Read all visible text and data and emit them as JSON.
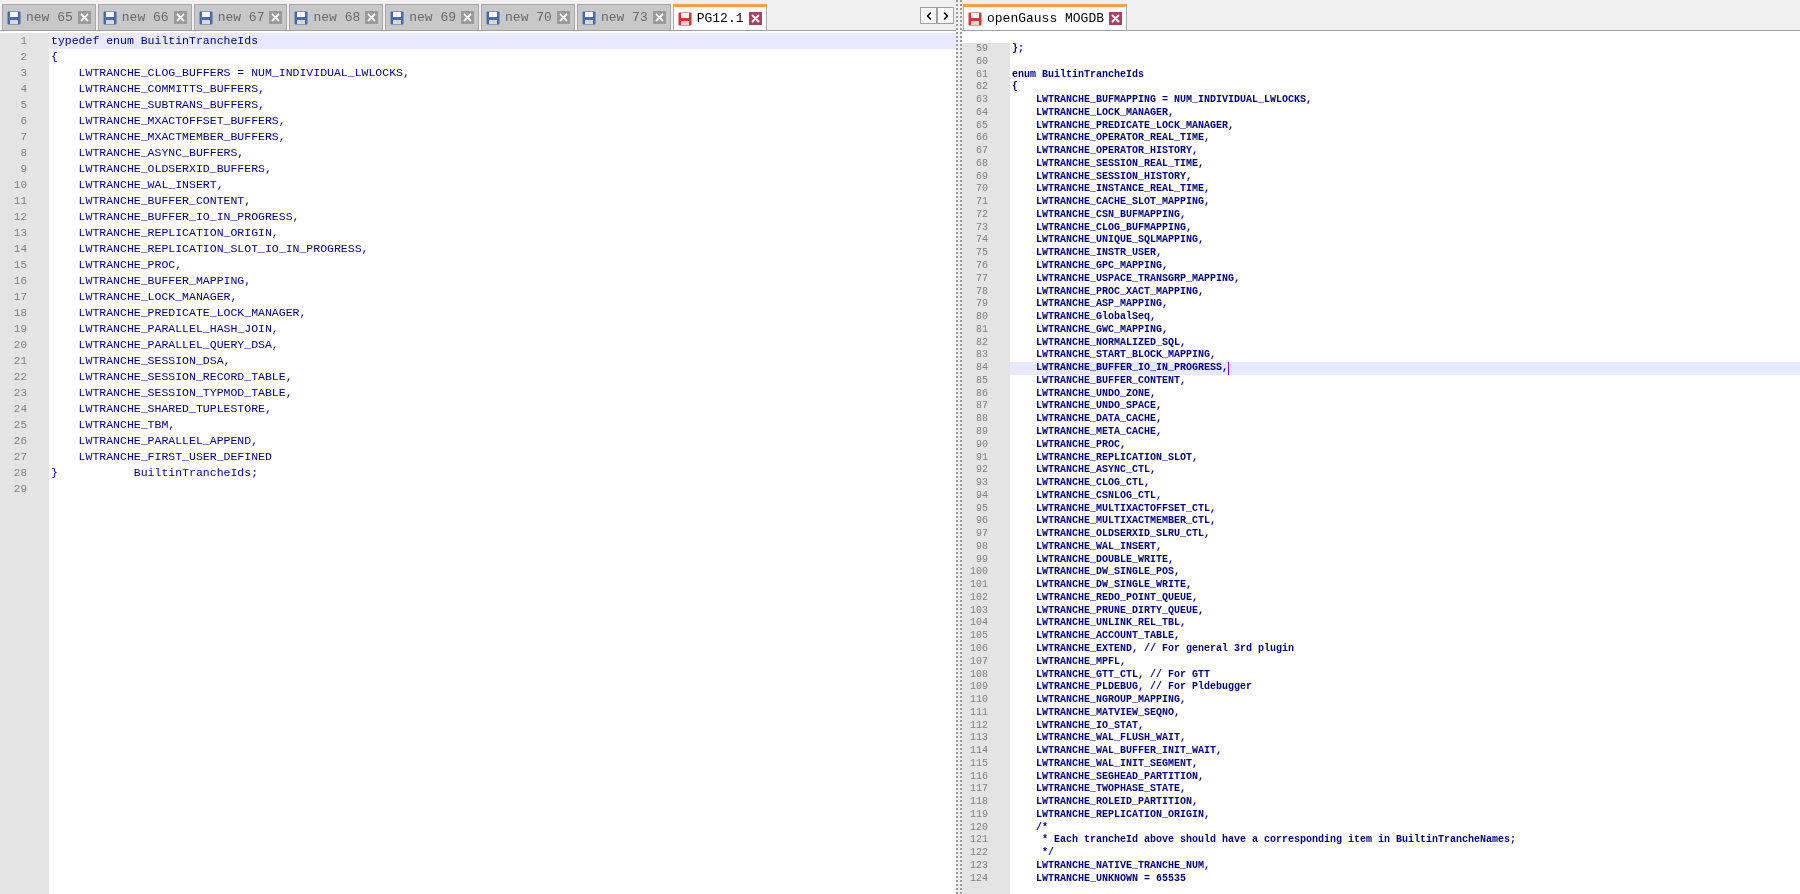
{
  "left_pane": {
    "tabs": [
      {
        "label": "new 65",
        "selected": false,
        "modified": false
      },
      {
        "label": "new 66",
        "selected": false,
        "modified": false
      },
      {
        "label": "new 67",
        "selected": false,
        "modified": false
      },
      {
        "label": "new 68",
        "selected": false,
        "modified": false
      },
      {
        "label": "new 69",
        "selected": false,
        "modified": false
      },
      {
        "label": "new 70",
        "selected": false,
        "modified": false
      },
      {
        "label": "new 73",
        "selected": false,
        "modified": false
      },
      {
        "label": "PG12.1",
        "selected": true,
        "modified": true
      }
    ],
    "lines": [
      {
        "number": "1",
        "text": "typedef enum BuiltinTrancheIds",
        "current": true
      },
      {
        "number": "2",
        "text": "{",
        "current": false
      },
      {
        "number": "3",
        "text": "    LWTRANCHE_CLOG_BUFFERS = NUM_INDIVIDUAL_LWLOCKS,",
        "current": false
      },
      {
        "number": "4",
        "text": "    LWTRANCHE_COMMITTS_BUFFERS,",
        "current": false
      },
      {
        "number": "5",
        "text": "    LWTRANCHE_SUBTRANS_BUFFERS,",
        "current": false
      },
      {
        "number": "6",
        "text": "    LWTRANCHE_MXACTOFFSET_BUFFERS,",
        "current": false
      },
      {
        "number": "7",
        "text": "    LWTRANCHE_MXACTMEMBER_BUFFERS,",
        "current": false
      },
      {
        "number": "8",
        "text": "    LWTRANCHE_ASYNC_BUFFERS,",
        "current": false
      },
      {
        "number": "9",
        "text": "    LWTRANCHE_OLDSERXID_BUFFERS,",
        "current": false
      },
      {
        "number": "10",
        "text": "    LWTRANCHE_WAL_INSERT,",
        "current": false
      },
      {
        "number": "11",
        "text": "    LWTRANCHE_BUFFER_CONTENT,",
        "current": false
      },
      {
        "number": "12",
        "text": "    LWTRANCHE_BUFFER_IO_IN_PROGRESS,",
        "current": false
      },
      {
        "number": "13",
        "text": "    LWTRANCHE_REPLICATION_ORIGIN,",
        "current": false
      },
      {
        "number": "14",
        "text": "    LWTRANCHE_REPLICATION_SLOT_IO_IN_PROGRESS,",
        "current": false
      },
      {
        "number": "15",
        "text": "    LWTRANCHE_PROC,",
        "current": false
      },
      {
        "number": "16",
        "text": "    LWTRANCHE_BUFFER_MAPPING,",
        "current": false
      },
      {
        "number": "17",
        "text": "    LWTRANCHE_LOCK_MANAGER,",
        "current": false
      },
      {
        "number": "18",
        "text": "    LWTRANCHE_PREDICATE_LOCK_MANAGER,",
        "current": false
      },
      {
        "number": "19",
        "text": "    LWTRANCHE_PARALLEL_HASH_JOIN,",
        "current": false
      },
      {
        "number": "20",
        "text": "    LWTRANCHE_PARALLEL_QUERY_DSA,",
        "current": false
      },
      {
        "number": "21",
        "text": "    LWTRANCHE_SESSION_DSA,",
        "current": false
      },
      {
        "number": "22",
        "text": "    LWTRANCHE_SESSION_RECORD_TABLE,",
        "current": false
      },
      {
        "number": "23",
        "text": "    LWTRANCHE_SESSION_TYPMOD_TABLE,",
        "current": false
      },
      {
        "number": "24",
        "text": "    LWTRANCHE_SHARED_TUPLESTORE,",
        "current": false
      },
      {
        "number": "25",
        "text": "    LWTRANCHE_TBM,",
        "current": false
      },
      {
        "number": "26",
        "text": "    LWTRANCHE_PARALLEL_APPEND,",
        "current": false
      },
      {
        "number": "27",
        "text": "    LWTRANCHE_FIRST_USER_DEFINED",
        "current": false
      },
      {
        "number": "28",
        "text": "}           BuiltinTrancheIds;",
        "current": false
      },
      {
        "number": "29",
        "current": false
      }
    ]
  },
  "right_pane": {
    "tabs": [
      {
        "label": "openGauss MOGDB",
        "selected": true,
        "modified": true
      }
    ],
    "caret": true,
    "lines": [
      {
        "number": "59",
        "text": "};",
        "current": false
      },
      {
        "number": "60",
        "current": false
      },
      {
        "number": "61",
        "text": "enum BuiltinTrancheIds",
        "current": false
      },
      {
        "number": "62",
        "text": "{",
        "current": false
      },
      {
        "number": "63",
        "text": "    LWTRANCHE_BUFMAPPING = NUM_INDIVIDUAL_LWLOCKS,",
        "current": false
      },
      {
        "number": "64",
        "text": "    LWTRANCHE_LOCK_MANAGER,",
        "current": false
      },
      {
        "number": "65",
        "text": "    LWTRANCHE_PREDICATE_LOCK_MANAGER,",
        "current": false
      },
      {
        "number": "66",
        "text": "    LWTRANCHE_OPERATOR_REAL_TIME,",
        "current": false
      },
      {
        "number": "67",
        "text": "    LWTRANCHE_OPERATOR_HISTORY,",
        "current": false
      },
      {
        "number": "68",
        "text": "    LWTRANCHE_SESSION_REAL_TIME,",
        "current": false
      },
      {
        "number": "69",
        "text": "    LWTRANCHE_SESSION_HISTORY,",
        "current": false
      },
      {
        "number": "70",
        "text": "    LWTRANCHE_INSTANCE_REAL_TIME,",
        "current": false
      },
      {
        "number": "71",
        "text": "    LWTRANCHE_CACHE_SLOT_MAPPING,",
        "current": false
      },
      {
        "number": "72",
        "text": "    LWTRANCHE_CSN_BUFMAPPING,",
        "current": false
      },
      {
        "number": "73",
        "text": "    LWTRANCHE_CLOG_BUFMAPPING,",
        "current": false
      },
      {
        "number": "74",
        "text": "    LWTRANCHE_UNIQUE_SQLMAPPING,",
        "current": false
      },
      {
        "number": "75",
        "text": "    LWTRANCHE_INSTR_USER,",
        "current": false
      },
      {
        "number": "76",
        "text": "    LWTRANCHE_GPC_MAPPING,",
        "current": false
      },
      {
        "number": "77",
        "text": "    LWTRANCHE_USPACE_TRANSGRP_MAPPING,",
        "current": false
      },
      {
        "number": "78",
        "text": "    LWTRANCHE_PROC_XACT_MAPPING,",
        "current": false
      },
      {
        "number": "79",
        "text": "    LWTRANCHE_ASP_MAPPING,",
        "current": false
      },
      {
        "number": "80",
        "text": "    LWTRANCHE_GlobalSeq,",
        "current": false
      },
      {
        "number": "81",
        "text": "    LWTRANCHE_GWC_MAPPING,",
        "current": false
      },
      {
        "number": "82",
        "text": "    LWTRANCHE_NORMALIZED_SQL,",
        "current": false
      },
      {
        "number": "83",
        "text": "    LWTRANCHE_START_BLOCK_MAPPING,",
        "current": false
      },
      {
        "number": "84",
        "text": "    LWTRANCHE_BUFFER_IO_IN_PROGRESS,",
        "current": true
      },
      {
        "number": "85",
        "text": "    LWTRANCHE_BUFFER_CONTENT,",
        "current": false
      },
      {
        "number": "86",
        "text": "    LWTRANCHE_UNDO_ZONE,",
        "current": false
      },
      {
        "number": "87",
        "text": "    LWTRANCHE_UNDO_SPACE,",
        "current": false
      },
      {
        "number": "88",
        "text": "    LWTRANCHE_DATA_CACHE,",
        "current": false
      },
      {
        "number": "89",
        "text": "    LWTRANCHE_META_CACHE,",
        "current": false
      },
      {
        "number": "90",
        "text": "    LWTRANCHE_PROC,",
        "current": false
      },
      {
        "number": "91",
        "text": "    LWTRANCHE_REPLICATION_SLOT,",
        "current": false
      },
      {
        "number": "92",
        "text": "    LWTRANCHE_ASYNC_CTL,",
        "current": false
      },
      {
        "number": "93",
        "text": "    LWTRANCHE_CLOG_CTL,",
        "current": false
      },
      {
        "number": "94",
        "text": "    LWTRANCHE_CSNLOG_CTL,",
        "current": false
      },
      {
        "number": "95",
        "text": "    LWTRANCHE_MULTIXACTOFFSET_CTL,",
        "current": false
      },
      {
        "number": "96",
        "text": "    LWTRANCHE_MULTIXACTMEMBER_CTL,",
        "current": false
      },
      {
        "number": "97",
        "text": "    LWTRANCHE_OLDSERXID_SLRU_CTL,",
        "current": false
      },
      {
        "number": "98",
        "text": "    LWTRANCHE_WAL_INSERT,",
        "current": false
      },
      {
        "number": "99",
        "text": "    LWTRANCHE_DOUBLE_WRITE,",
        "current": false
      },
      {
        "number": "100",
        "text": "    LWTRANCHE_DW_SINGLE_POS,",
        "current": false
      },
      {
        "number": "101",
        "text": "    LWTRANCHE_DW_SINGLE_WRITE,",
        "current": false
      },
      {
        "number": "102",
        "text": "    LWTRANCHE_REDO_POINT_QUEUE,",
        "current": false
      },
      {
        "number": "103",
        "text": "    LWTRANCHE_PRUNE_DIRTY_QUEUE,",
        "current": false
      },
      {
        "number": "104",
        "text": "    LWTRANCHE_UNLINK_REL_TBL,",
        "current": false
      },
      {
        "number": "105",
        "text": "    LWTRANCHE_ACCOUNT_TABLE,",
        "current": false
      },
      {
        "number": "106",
        "text": "    LWTRANCHE_EXTEND, // For general 3rd plugin",
        "current": false
      },
      {
        "number": "107",
        "text": "    LWTRANCHE_MPFL,",
        "current": false
      },
      {
        "number": "108",
        "text": "    LWTRANCHE_GTT_CTL, // For GTT",
        "current": false
      },
      {
        "number": "109",
        "text": "    LWTRANCHE_PLDEBUG, // For Pldebugger",
        "current": false
      },
      {
        "number": "110",
        "text": "    LWTRANCHE_NGROUP_MAPPING,",
        "current": false
      },
      {
        "number": "111",
        "text": "    LWTRANCHE_MATVIEW_SEQNO,",
        "current": false
      },
      {
        "number": "112",
        "text": "    LWTRANCHE_IO_STAT,",
        "current": false
      },
      {
        "number": "113",
        "text": "    LWTRANCHE_WAL_FLUSH_WAIT,",
        "current": false
      },
      {
        "number": "114",
        "text": "    LWTRANCHE_WAL_BUFFER_INIT_WAIT,",
        "current": false
      },
      {
        "number": "115",
        "text": "    LWTRANCHE_WAL_INIT_SEGMENT,",
        "current": false
      },
      {
        "number": "116",
        "text": "    LWTRANCHE_SEGHEAD_PARTITION,",
        "current": false
      },
      {
        "number": "117",
        "text": "    LWTRANCHE_TWOPHASE_STATE,",
        "current": false
      },
      {
        "number": "118",
        "text": "    LWTRANCHE_ROLEID_PARTITION,",
        "current": false
      },
      {
        "number": "119",
        "text": "    LWTRANCHE_REPLICATION_ORIGIN,",
        "current": false
      },
      {
        "number": "120",
        "text": "    /*",
        "current": false
      },
      {
        "number": "121",
        "text": "     * Each trancheId above should have a corresponding item in BuiltinTrancheNames;",
        "current": false
      },
      {
        "number": "122",
        "text": "     */",
        "current": false
      },
      {
        "number": "123",
        "text": "    LWTRANCHE_NATIVE_TRANCHE_NUM,",
        "current": false
      },
      {
        "number": "124",
        "text": "    LWTRANCHE_UNKNOWN = 65535",
        "current": false
      }
    ]
  }
}
